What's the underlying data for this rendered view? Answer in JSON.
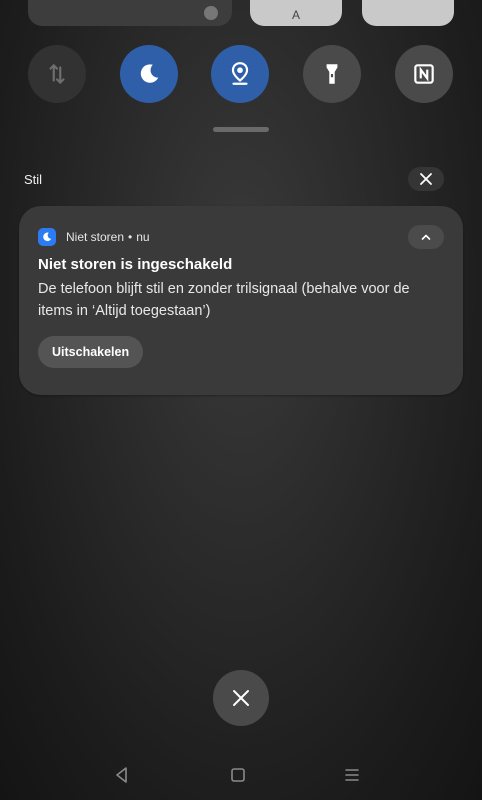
{
  "top_tiles": [
    {
      "name": "tile-partial-1",
      "glyph": ""
    },
    {
      "name": "tile-partial-2",
      "glyph": "A"
    },
    {
      "name": "tile-partial-3",
      "glyph": ""
    }
  ],
  "quick_settings": [
    {
      "name": "mobile-data-toggle",
      "icon": "mobile-data-icon",
      "state": "off"
    },
    {
      "name": "do-not-disturb-toggle",
      "icon": "moon-icon",
      "state": "on"
    },
    {
      "name": "location-toggle",
      "icon": "location-icon",
      "state": "on"
    },
    {
      "name": "flashlight-toggle",
      "icon": "flashlight-icon",
      "state": "off"
    },
    {
      "name": "nfc-toggle",
      "icon": "nfc-icon",
      "state": "off"
    }
  ],
  "section": {
    "title": "Stil"
  },
  "notification": {
    "app_name": "Niet storen",
    "separator": "•",
    "time": "nu",
    "title": "Niet storen is ingeschakeld",
    "body": "De telefoon blijft stil en zonder trilsignaal (behalve voor de items in ‘Altijd toegestaan’)",
    "action_label": "Uitschakelen"
  },
  "colors": {
    "accent": "#2f5fa8",
    "app_icon": "#2b7bf2",
    "card": "#3a3a3a"
  }
}
